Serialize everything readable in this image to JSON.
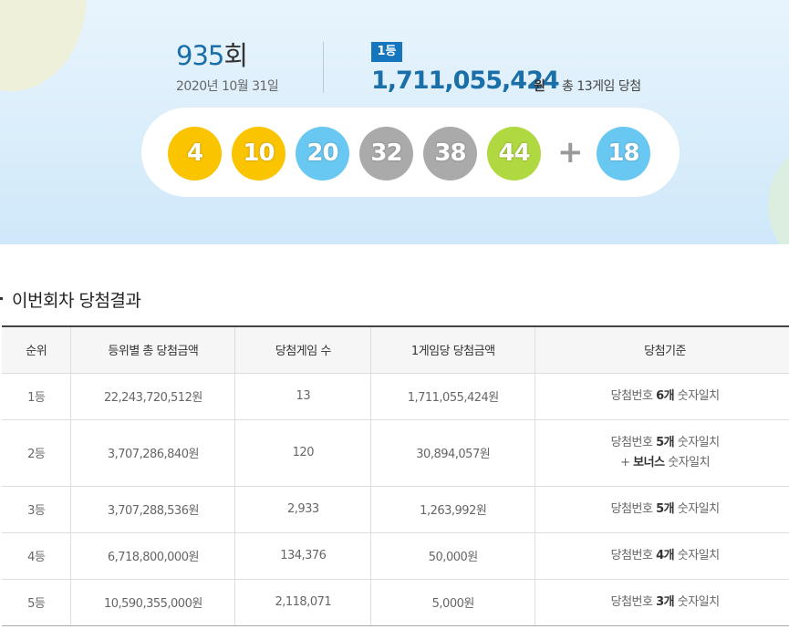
{
  "draw": {
    "round_number": "935",
    "round_suffix": "회",
    "date": "2020년 10월 31일",
    "first_prize_badge": "1등",
    "first_prize_amount": "1,711,055,424",
    "first_prize_unit": "원",
    "first_prize_winners": "총 13게임 당첨",
    "numbers": [
      "4",
      "10",
      "20",
      "32",
      "38",
      "44"
    ],
    "plus_symbol": "+",
    "bonus_number": "18"
  },
  "colors": {
    "ball_1_10": "#fbc400",
    "ball_11_20": "#69c8f2",
    "ball_31_40": "#aaaaaa",
    "ball_41_45": "#b0d840",
    "accent": "#1576bd"
  },
  "section": {
    "title": "이번회차 당첨결과"
  },
  "table": {
    "headers": [
      "순위",
      "등위별 총 당첨금액",
      "당첨게임 수",
      "1게임당 당첨금액",
      "당첨기준"
    ],
    "rows": [
      {
        "rank": "1등",
        "total": "22,243,720,512원",
        "games": "13",
        "per_game": "1,711,055,424원",
        "crit_pre": "당첨번호 ",
        "crit_bold": "6개",
        "crit_post": " 숫자일치"
      },
      {
        "rank": "2등",
        "total": "3,707,286,840원",
        "games": "120",
        "per_game": "30,894,057원",
        "crit_pre": "당첨번호 ",
        "crit_bold": "5개",
        "crit_post": " 숫자일치",
        "crit2_pre": "+ ",
        "crit2_bold": "보너스",
        "crit2_post": " 숫자일치"
      },
      {
        "rank": "3등",
        "total": "3,707,288,536원",
        "games": "2,933",
        "per_game": "1,263,992원",
        "crit_pre": "당첨번호 ",
        "crit_bold": "5개",
        "crit_post": " 숫자일치"
      },
      {
        "rank": "4등",
        "total": "6,718,800,000원",
        "games": "134,376",
        "per_game": "50,000원",
        "crit_pre": "당첨번호 ",
        "crit_bold": "4개",
        "crit_post": " 숫자일치"
      },
      {
        "rank": "5등",
        "total": "10,590,355,000원",
        "games": "2,118,071",
        "per_game": "5,000원",
        "crit_pre": "당첨번호 ",
        "crit_bold": "3개",
        "crit_post": " 숫자일치"
      }
    ]
  }
}
